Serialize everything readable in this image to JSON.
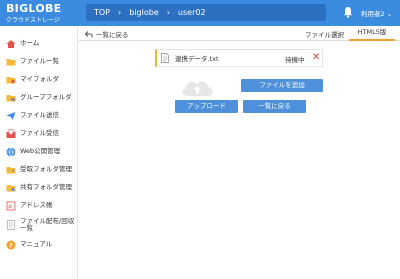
{
  "header": {
    "logo_main": "BIGLOBE",
    "logo_sub": "クラウドストレージ",
    "breadcrumb": [
      "TOP",
      "biglobe",
      "user02"
    ],
    "user": "利用者2 ⌄"
  },
  "sidebar": {
    "items": [
      {
        "label": "ホーム",
        "icon": "home-icon"
      },
      {
        "label": "ファイル一覧",
        "icon": "folder-icon"
      },
      {
        "label": "マイフォルダ",
        "icon": "my-folder-icon"
      },
      {
        "label": "グループフォルダ",
        "icon": "group-folder-icon"
      },
      {
        "label": "ファイル送信",
        "icon": "send-icon"
      },
      {
        "label": "ファイル受信",
        "icon": "receive-icon"
      },
      {
        "label": "Web公開管理",
        "icon": "globe-icon"
      },
      {
        "label": "受取フォルダ管理",
        "icon": "inbox-folder-icon"
      },
      {
        "label": "共有フォルダ管理",
        "icon": "shared-folder-icon"
      },
      {
        "label": "アドレス帳",
        "icon": "address-book-icon"
      },
      {
        "label": "ファイル配布/回収一覧",
        "icon": "distribute-icon"
      },
      {
        "label": "マニュアル",
        "icon": "help-icon"
      }
    ]
  },
  "toolbar": {
    "back_label": "一覧に戻る",
    "tab_file": "ファイル選択",
    "tab_html5": "HTML5版"
  },
  "upload": {
    "filename": "連携データ.txt",
    "status": "待機中",
    "close": "✕"
  },
  "buttons": {
    "add_file": "ファイルを追加",
    "upload": "アップロード",
    "back_to_list": "一覧に戻る"
  },
  "colors": {
    "header": "#3b8be0",
    "breadcrumb_bg": "#2d6fc0",
    "button": "#4e90d9",
    "active_tab": "#f2a130",
    "delete": "#e04848"
  }
}
